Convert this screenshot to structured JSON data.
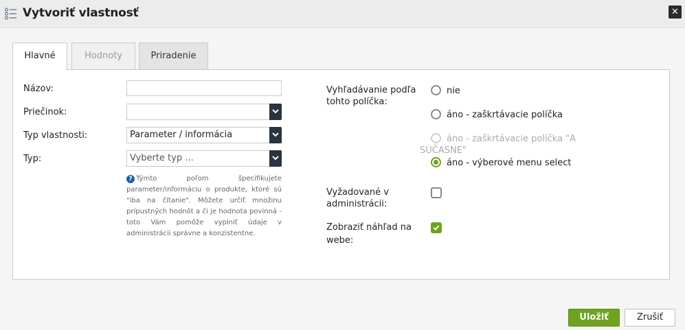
{
  "dialog": {
    "title": "Vytvoriť vlastnosť",
    "close_label": "✕",
    "title_icon": "list-icon",
    "close_icon": "close-icon"
  },
  "tabs": [
    {
      "label": "Hlavné",
      "active": true
    },
    {
      "label": "Hodnoty",
      "active": false,
      "disabled": true
    },
    {
      "label": "Priradenie",
      "active": false
    }
  ],
  "form": {
    "nazov_label": "Názov:",
    "nazov_value": "",
    "priecinok_label": "Priečinok:",
    "priecinok_value": "",
    "typ_vlastnosti_label": "Typ vlastnosti:",
    "typ_vlastnosti_value": "Parameter / informácia",
    "typ_label": "Typ:",
    "typ_placeholder": "Vyberte typ ...",
    "help_text": "Týmto poľom špecifikujete parameter/informáciu o produkte, ktoré sú \"iba na čítanie\". Môžete určiť množinu prípustných hodnôt a či je hodnota povinná - toto Vám pomôže vyplniť údaje v administrácii správne a konzistentne."
  },
  "search": {
    "label_line1": "Vyhľadávanie podľa",
    "label_line2": "tohto políčka:",
    "options": [
      {
        "label": "nie",
        "checked": false,
        "disabled": false
      },
      {
        "label": "áno - zaškrtávacie políčka",
        "checked": false,
        "disabled": false
      },
      {
        "label_line1": "áno - zaškrtávacie políčka \"A",
        "label_line2": "SÚČASNE\"",
        "checked": false,
        "disabled": true
      },
      {
        "label": "áno - výberové menu select",
        "checked": true,
        "disabled": false
      }
    ]
  },
  "required": {
    "label_line1": "Vyžadované v",
    "label_line2": "administrácii:",
    "checked": false
  },
  "preview": {
    "label_line1": "Zobraziť náhľad na",
    "label_line2": "webe:",
    "checked": true
  },
  "footer": {
    "save_label": "Uložiť",
    "cancel_label": "Zrušiť"
  },
  "colors": {
    "accent": "#6ea31f",
    "select_arrow": "#2a3340",
    "help_icon": "#1d5fa6"
  }
}
